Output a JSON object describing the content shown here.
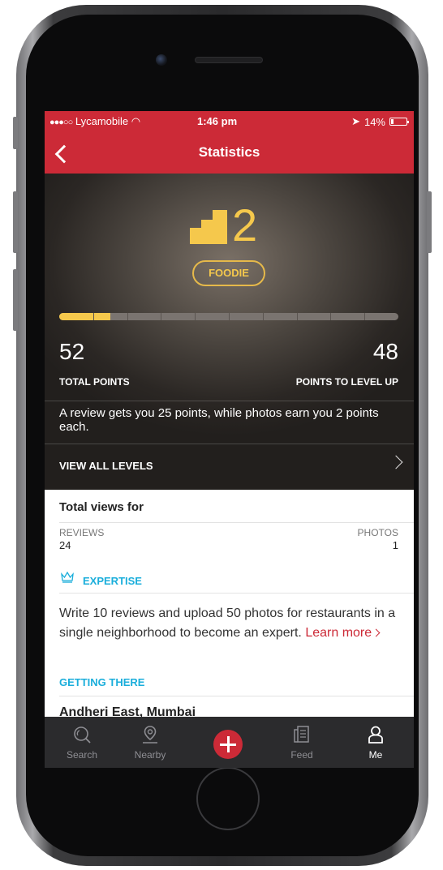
{
  "status_bar": {
    "signal": "●●●○○",
    "carrier": "Lycamobile",
    "time": "1:46 pm",
    "battery": "14%",
    "battery_level": 0.14
  },
  "nav": {
    "title": "Statistics"
  },
  "level": {
    "number": "2",
    "badge": "FOODIE",
    "progress": 0.15,
    "accent_color": "#f5c84c",
    "total_points": "52",
    "total_points_label": "TOTAL POINTS",
    "points_to_level": "48",
    "points_to_level_label": "POINTS TO LEVEL UP",
    "info": "A review gets you 25 points, while photos earn you 2 points each.",
    "view_all": "VIEW ALL LEVELS"
  },
  "views": {
    "title": "Total views for",
    "reviews_label": "REVIEWS",
    "reviews_value": "24",
    "photos_label": "PHOTOS",
    "photos_value": "1"
  },
  "expertise": {
    "title": "EXPERTISE",
    "description": "Write 10 reviews and upload 50 photos for restaurants in a single neighborhood to become an expert.",
    "learn_more": "Learn more",
    "getting_there": "GETTING THERE",
    "neighborhood": "Andheri East, Mumbai"
  },
  "tabs": {
    "search": "Search",
    "nearby": "Nearby",
    "feed": "Feed",
    "me": "Me"
  },
  "colors": {
    "brand_red": "#cc2a37",
    "link_blue": "#1aaedb",
    "gold": "#f5c84c"
  }
}
